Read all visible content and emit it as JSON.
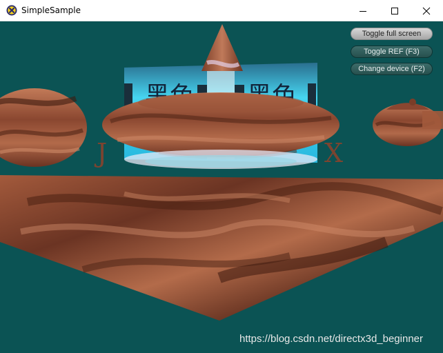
{
  "window": {
    "title": "SimpleSample",
    "app_icon": "directx-icon",
    "controls": [
      "minimize-icon",
      "maximize-icon",
      "close-icon"
    ]
  },
  "hud": {
    "toggle_fullscreen": "Toggle full screen",
    "toggle_ref": "Toggle REF (F3)",
    "change_device": "Change device (F2)"
  },
  "scene": {
    "background_color": "#0b5354",
    "billboard_text": "黑色",
    "left_letter": "J",
    "right_letter": "X",
    "texture_color": "#8a4a32"
  },
  "watermark": "https://blog.csdn.net/directx3d_beginner"
}
